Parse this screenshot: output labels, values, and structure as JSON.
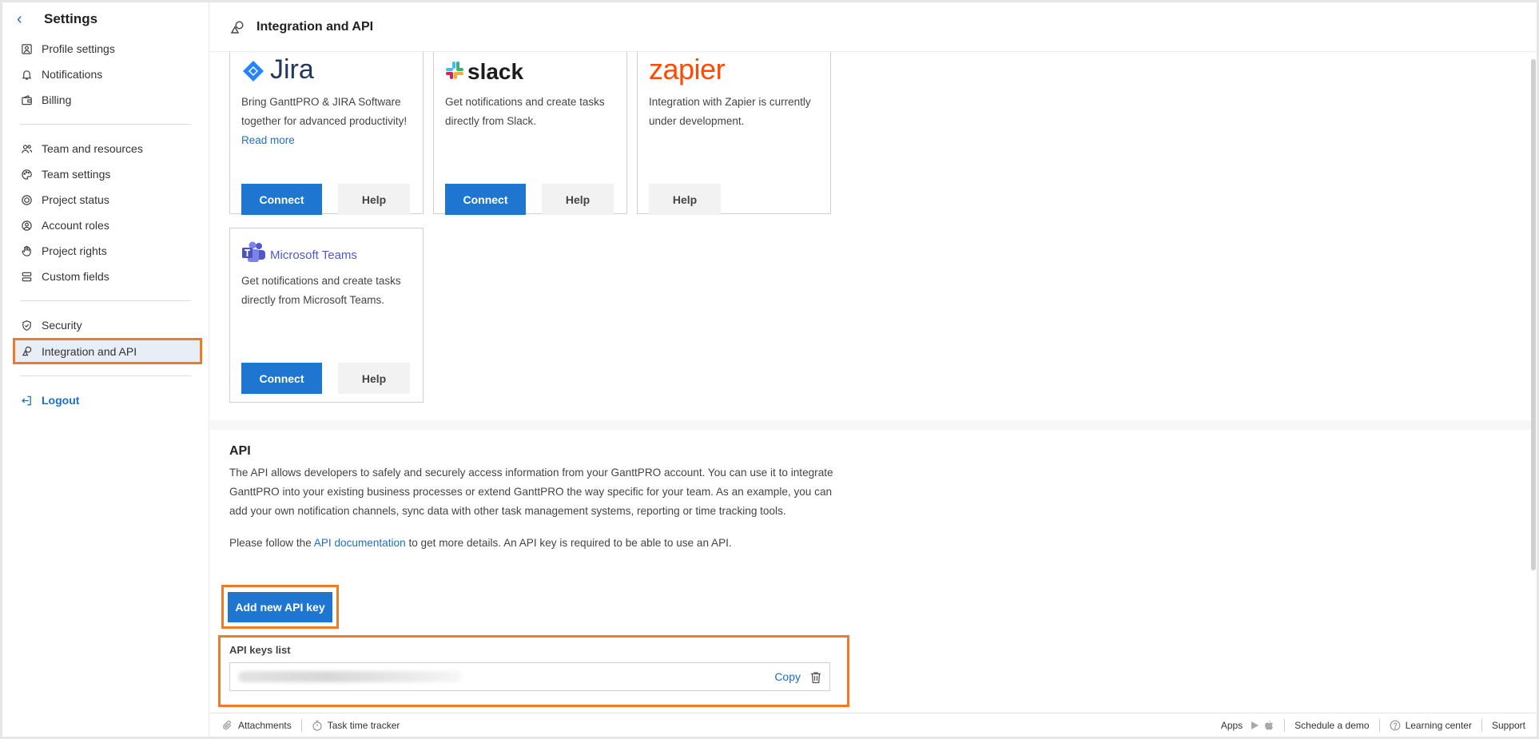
{
  "sidebar": {
    "title": "Settings",
    "group1": [
      {
        "label": "Profile settings",
        "icon": "profile-icon"
      },
      {
        "label": "Notifications",
        "icon": "bell-icon"
      },
      {
        "label": "Billing",
        "icon": "wallet-icon"
      }
    ],
    "group2": [
      {
        "label": "Team and resources",
        "icon": "team-icon"
      },
      {
        "label": "Team settings",
        "icon": "palette-icon"
      },
      {
        "label": "Project status",
        "icon": "target-icon"
      },
      {
        "label": "Account roles",
        "icon": "user-circle-icon"
      },
      {
        "label": "Project rights",
        "icon": "hand-icon"
      },
      {
        "label": "Custom fields",
        "icon": "fields-icon"
      }
    ],
    "group3": [
      {
        "label": "Security",
        "icon": "shield-icon"
      },
      {
        "label": "Integration and API",
        "icon": "shapes-icon",
        "active": true
      }
    ],
    "logout": "Logout"
  },
  "topbar": {
    "title": "Integration and API"
  },
  "integrations": {
    "jira": {
      "name": "Jira",
      "desc": "Bring GanttPRO & JIRA Software together for advanced productivity!",
      "link": "Read more",
      "connect": "Connect",
      "help": "Help"
    },
    "slack": {
      "name": "slack",
      "desc": "Get notifications and create tasks directly from Slack.",
      "connect": "Connect",
      "help": "Help"
    },
    "zapier": {
      "name": "zapier",
      "desc": "Integration with Zapier is currently under development.",
      "help": "Help"
    },
    "teams": {
      "name": "Microsoft Teams",
      "desc": "Get notifications and create tasks directly from Microsoft Teams.",
      "connect": "Connect",
      "help": "Help"
    }
  },
  "api": {
    "heading": "API",
    "description": "The API allows developers to safely and securely access information from your GanttPRO account. You can use it to integrate GanttPRO into your existing business processes or extend GanttPRO the way specific for your team. As an example, you can add your own notification channels, sync data with other task management systems, reporting or time tracking tools.",
    "follow_prefix": "Please follow the ",
    "doc_link": "API documentation",
    "follow_suffix": " to get more details. An API key is required to be able to use an API.",
    "add_key": "Add new API key",
    "keys_label": "API keys list",
    "copy": "Copy"
  },
  "footer": {
    "attachments": "Attachments",
    "time_tracker": "Task time tracker",
    "apps": "Apps",
    "schedule": "Schedule a demo",
    "learning": "Learning center",
    "support": "Support"
  },
  "colors": {
    "accent": "#1f76d1",
    "highlight": "#f07a26",
    "jira": "#2684ff",
    "zapier": "#ff4a00",
    "teams": "#5059c9"
  }
}
